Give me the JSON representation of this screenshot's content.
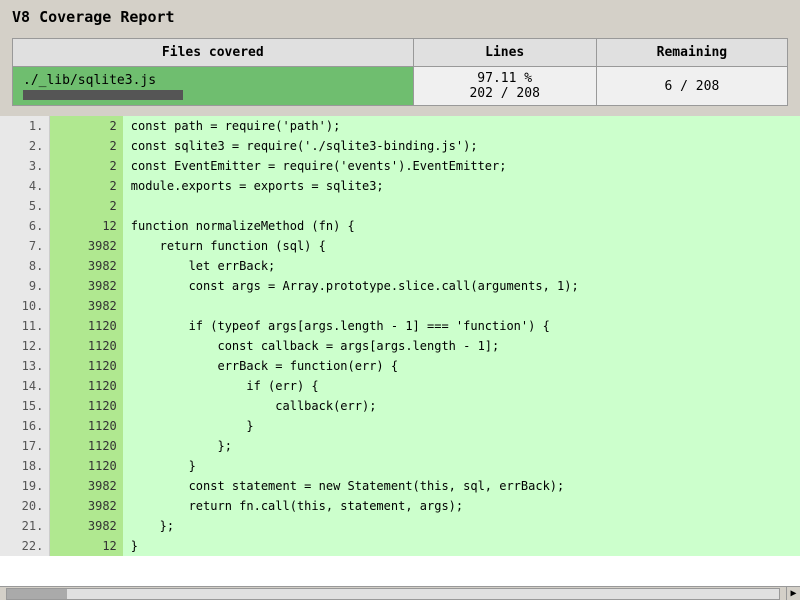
{
  "title": "V8 Coverage Report",
  "table": {
    "headers": [
      "Files covered",
      "Lines",
      "Remaining"
    ],
    "rows": [
      {
        "file": "./_lib/sqlite3.js",
        "lines_pct": "97.11 %",
        "lines_fraction": "202 / 208",
        "remaining": "6 / 208"
      }
    ]
  },
  "code_lines": [
    {
      "num": "1.",
      "hits": "2",
      "covered": true,
      "code": "const path = require('path');"
    },
    {
      "num": "2.",
      "hits": "2",
      "covered": true,
      "code": "const sqlite3 = require('./sqlite3-binding.js');"
    },
    {
      "num": "3.",
      "hits": "2",
      "covered": true,
      "code": "const EventEmitter = require('events').EventEmitter;"
    },
    {
      "num": "4.",
      "hits": "2",
      "covered": true,
      "code": "module.exports = exports = sqlite3;"
    },
    {
      "num": "5.",
      "hits": "2",
      "covered": true,
      "code": ""
    },
    {
      "num": "6.",
      "hits": "12",
      "covered": true,
      "code": "function normalizeMethod (fn) {"
    },
    {
      "num": "7.",
      "hits": "3982",
      "covered": true,
      "code": "    return function (sql) {"
    },
    {
      "num": "8.",
      "hits": "3982",
      "covered": true,
      "code": "        let errBack;"
    },
    {
      "num": "9.",
      "hits": "3982",
      "covered": true,
      "code": "        const args = Array.prototype.slice.call(arguments, 1);"
    },
    {
      "num": "10.",
      "hits": "3982",
      "covered": true,
      "code": ""
    },
    {
      "num": "11.",
      "hits": "1120",
      "covered": true,
      "code": "        if (typeof args[args.length - 1] === 'function') {"
    },
    {
      "num": "12.",
      "hits": "1120",
      "covered": true,
      "code": "            const callback = args[args.length - 1];"
    },
    {
      "num": "13.",
      "hits": "1120",
      "covered": true,
      "code": "            errBack = function(err) {"
    },
    {
      "num": "14.",
      "hits": "1120",
      "covered": true,
      "code": "                if (err) {"
    },
    {
      "num": "15.",
      "hits": "1120",
      "covered": true,
      "code": "                    callback(err);"
    },
    {
      "num": "16.",
      "hits": "1120",
      "covered": true,
      "code": "                }"
    },
    {
      "num": "17.",
      "hits": "1120",
      "covered": true,
      "code": "            };"
    },
    {
      "num": "18.",
      "hits": "1120",
      "covered": true,
      "code": "        }"
    },
    {
      "num": "19.",
      "hits": "3982",
      "covered": true,
      "code": "        const statement = new Statement(this, sql, errBack);"
    },
    {
      "num": "20.",
      "hits": "3982",
      "covered": true,
      "code": "        return fn.call(this, statement, args);"
    },
    {
      "num": "21.",
      "hits": "3982",
      "covered": true,
      "code": "    };"
    },
    {
      "num": "22.",
      "hits": "12",
      "covered": true,
      "code": "}"
    }
  ]
}
